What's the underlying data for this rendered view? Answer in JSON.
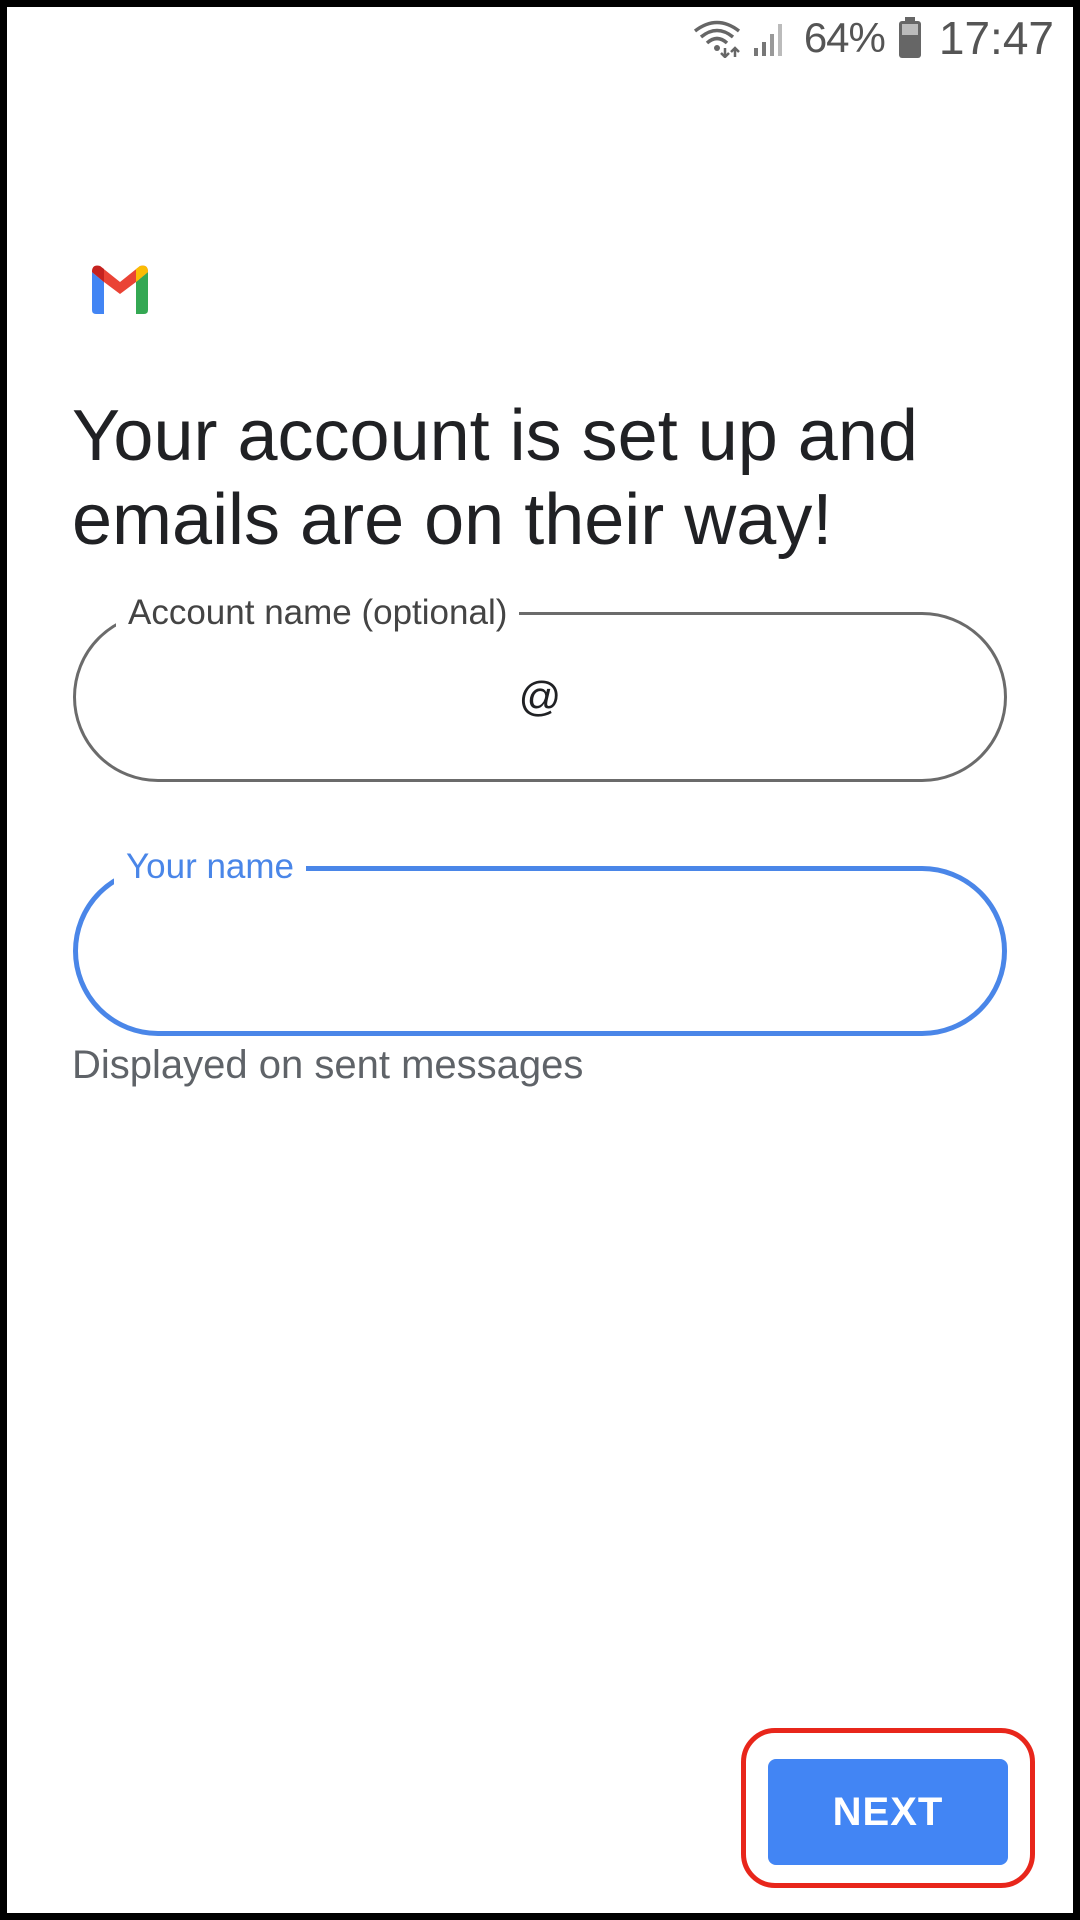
{
  "status_bar": {
    "battery_percent": "64%",
    "time": "17:47",
    "icons": [
      "wifi-icon",
      "signal-icon",
      "battery-icon"
    ]
  },
  "app": {
    "logo": "gmail-logo",
    "colors": {
      "logo_red": "#EA4335",
      "logo_blue": "#4285F4",
      "logo_green": "#34A853",
      "logo_yellow": "#FBBC04",
      "logo_dark_red": "#C5221F"
    }
  },
  "main": {
    "headline": "Your account is set up and emails are on their way!",
    "account_field": {
      "label": "Account name (optional)",
      "value": "@"
    },
    "name_field": {
      "label": "Your name",
      "value": "",
      "helper": "Displayed on sent messages"
    }
  },
  "footer": {
    "next_label": "NEXT"
  },
  "colors": {
    "accent": "#4A86E8",
    "button": "#4285F4",
    "highlight": "#E8261B",
    "text_primary": "#202124",
    "text_secondary": "#5F6368"
  }
}
